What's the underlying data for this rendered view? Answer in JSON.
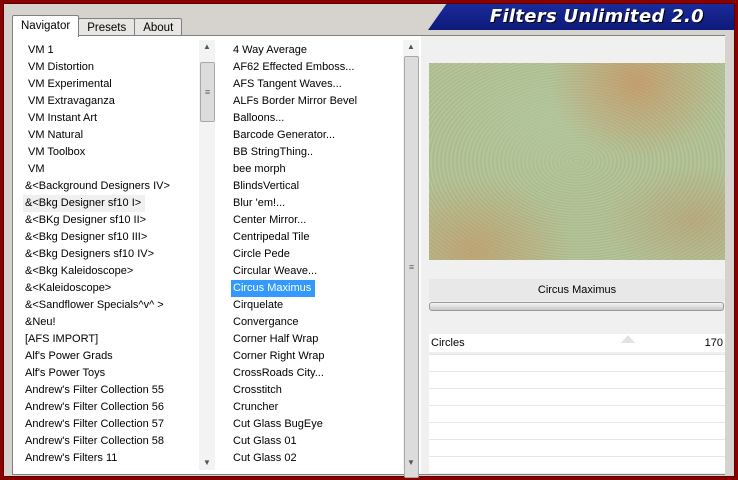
{
  "app": {
    "title": "Filters Unlimited 2.0"
  },
  "tabs": [
    {
      "label": "Navigator",
      "active": true
    },
    {
      "label": "Presets",
      "active": false
    },
    {
      "label": "About",
      "active": false
    }
  ],
  "categories": [
    "VM 1",
    "VM Distortion",
    "VM Experimental",
    "VM Extravaganza",
    "VM Instant Art",
    "VM Natural",
    "VM Toolbox",
    "VM",
    "&<Background Designers IV>",
    "&<Bkg Designer sf10 I>",
    "&<BKg Designer sf10 II>",
    "&<Bkg Designer sf10 III>",
    "&<Bkg Designers sf10 IV>",
    "&<Bkg Kaleidoscope>",
    "&<Kaleidoscope>",
    "&<Sandflower Specials^v^ >",
    "&Neu!",
    "[AFS IMPORT]",
    "Alf's Power Grads",
    "Alf's Power Toys",
    "Andrew's Filter Collection 55",
    "Andrew's Filter Collection 56",
    "Andrew's Filter Collection 57",
    "Andrew's Filter Collection 58",
    "Andrew's Filters 11"
  ],
  "filters": [
    "4 Way Average",
    "AF62 Effected Emboss...",
    "AFS Tangent Waves...",
    "ALFs Border Mirror Bevel",
    "Balloons...",
    "Barcode Generator...",
    "BB StringThing..",
    "bee morph",
    "BlindsVertical",
    "Blur 'em!...",
    "Center Mirror...",
    "Centripedal Tile",
    "Circle Pede",
    "Circular Weave...",
    "Circus Maximus",
    "Cirquelate",
    "Convergance",
    "Corner Half Wrap",
    "Corner Right Wrap",
    "CrossRoads City...",
    "Crosstitch",
    "Cruncher",
    "Cut Glass  BugEye",
    "Cut Glass 01",
    "Cut Glass 02"
  ],
  "selected_filter": "Circus Maximus",
  "hover_category": "&<Bkg Designer sf10 I>",
  "parameter": {
    "name": "Circles",
    "value": "170"
  },
  "colors": {
    "border": "#8a0000",
    "banner": "#0d1a7a",
    "selection": "#3399ff"
  }
}
